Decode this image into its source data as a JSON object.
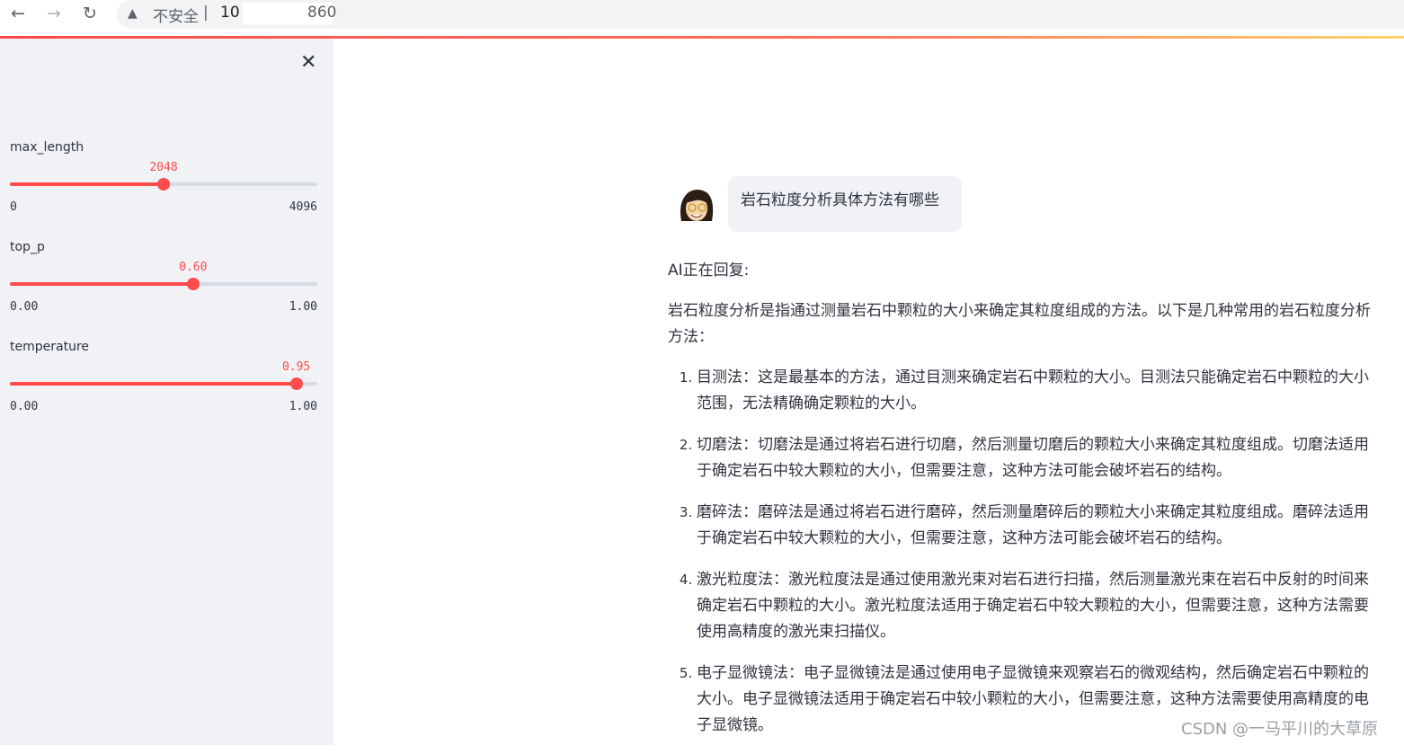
{
  "browser": {
    "insecure_label": "不安全",
    "address_host": "10",
    "address_port": "860"
  },
  "sidebar": {
    "sliders": [
      {
        "label": "max_length",
        "value": "2048",
        "min": "0",
        "max": "4096",
        "fraction": 0.5
      },
      {
        "label": "top_p",
        "value": "0.60",
        "min": "0.00",
        "max": "1.00",
        "fraction": 0.6
      },
      {
        "label": "temperature",
        "value": "0.95",
        "min": "0.00",
        "max": "1.00",
        "fraction": 0.95
      }
    ]
  },
  "chat": {
    "user_message": "岩石粒度分析具体方法有哪些",
    "ai_status": "AI正在回复:",
    "intro": "岩石粒度分析是指通过测量岩石中颗粒的大小来确定其粒度组成的方法。以下是几种常用的岩石粒度分析方法：",
    "items": [
      "目测法：这是最基本的方法，通过目测来确定岩石中颗粒的大小。目测法只能确定岩石中颗粒的大小范围，无法精确确定颗粒的大小。",
      "切磨法：切磨法是通过将岩石进行切磨，然后测量切磨后的颗粒大小来确定其粒度组成。切磨法适用于确定岩石中较大颗粒的大小，但需要注意，这种方法可能会破坏岩石的结构。",
      "磨碎法：磨碎法是通过将岩石进行磨碎，然后测量磨碎后的颗粒大小来确定其粒度组成。磨碎法适用于确定岩石中较大颗粒的大小，但需要注意，这种方法可能会破坏岩石的结构。",
      "激光粒度法：激光粒度法是通过使用激光束对岩石进行扫描，然后测量激光束在岩石中反射的时间来确定岩石中颗粒的大小。激光粒度法适用于确定岩石中较大颗粒的大小，但需要注意，这种方法需要使用高精度的激光束扫描仪。",
      "电子显微镜法：电子显微镜法是通过使用电子显微镜来观察岩石的微观结构，然后确定岩石中颗粒的大小。电子显微镜法适用于确定岩石中较小颗粒的大小，但需要注意，这种方法需要使用高精度的电子显微镜。"
    ]
  },
  "watermark": "CSDN @一马平川的大草原",
  "colors": {
    "accent": "#ff4b4b",
    "sidebar_bg": "#f0f2f6",
    "text": "#31333f"
  },
  "icons": [
    "back-arrow-icon",
    "forward-arrow-icon",
    "reload-icon",
    "warning-icon",
    "close-icon",
    "user-avatar-icon"
  ]
}
